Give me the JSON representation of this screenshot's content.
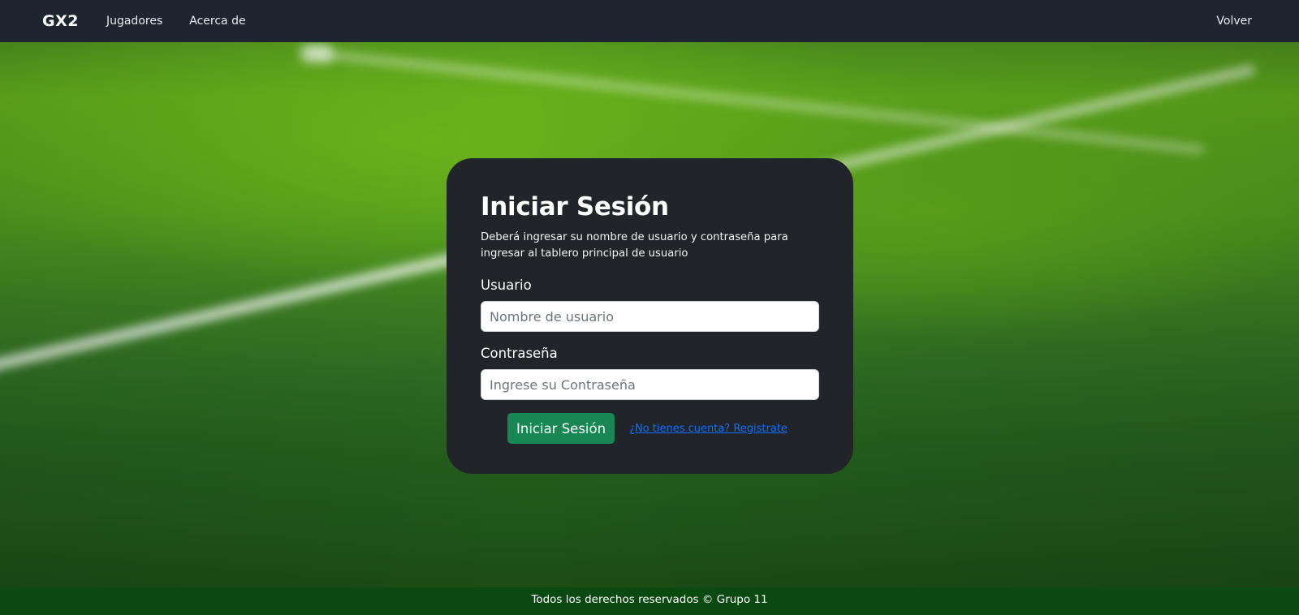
{
  "navbar": {
    "brand": "GX2",
    "links": [
      {
        "label": "Jugadores"
      },
      {
        "label": "Acerca de"
      }
    ],
    "right_link": "Volver"
  },
  "login": {
    "title": "Iniciar Sesión",
    "description": "Deberá ingresar su nombre de usuario y contraseña para ingresar al tablero principal de usuario",
    "username_label": "Usuario",
    "username_placeholder": "Nombre de usuario",
    "username_value": "",
    "password_label": "Contraseña",
    "password_placeholder": "Ingrese su Contraseña",
    "password_value": "",
    "submit_label": "Iniciar Sesión",
    "register_link": "¿No tienes cuenta? Registrate"
  },
  "footer": {
    "text": "Todos los derechos reservados © Grupo 11"
  },
  "colors": {
    "navbar_bg": "#1c2530",
    "card_bg": "#212529",
    "submit_button": "#198754",
    "link": "#0d6efd",
    "footer_bg": "#0a4a10"
  }
}
